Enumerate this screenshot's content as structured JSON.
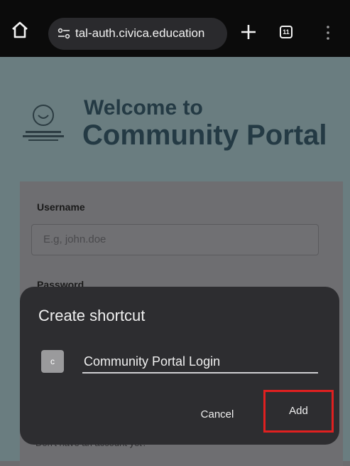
{
  "browser": {
    "url": "tal-auth.civica.education",
    "tab_count": "11"
  },
  "page": {
    "welcome_line": "Welcome to",
    "title": "Community Portal",
    "username_label": "Username",
    "username_placeholder": "E.g, john.doe",
    "password_label": "Password",
    "signup_hint": "Don't have an account yet?"
  },
  "dialog": {
    "title": "Create shortcut",
    "favicon_letter": "c",
    "shortcut_name": "Community Portal Login",
    "cancel_label": "Cancel",
    "add_label": "Add"
  },
  "colors": {
    "highlight": "#e02020",
    "dialog_bg": "#2d2d30",
    "title_text": "#243a44"
  }
}
